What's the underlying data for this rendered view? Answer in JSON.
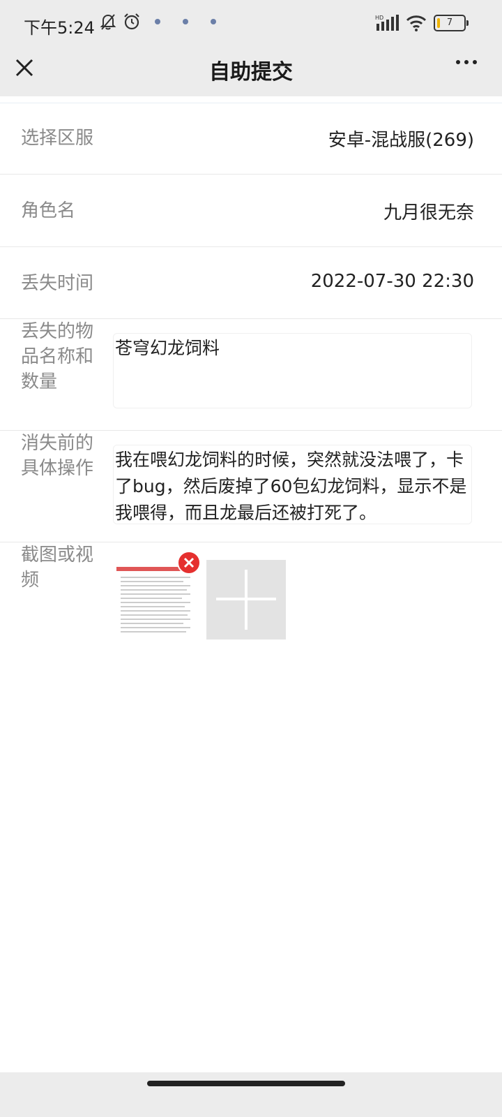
{
  "status_bar": {
    "time": "下午5:24",
    "icons_left": [
      "bell-off-icon",
      "alarm-icon"
    ],
    "network": "HD",
    "battery": "7",
    "battery_color": "#f0b400"
  },
  "nav": {
    "title": "自助提交",
    "close_icon": "close-icon",
    "more_icon": "more-icon"
  },
  "form": {
    "server_label": "选择区服",
    "server_value": "安卓-混战服(269)",
    "role_label": "角色名",
    "role_value": "九月很无奈",
    "time_label": "丢失时间",
    "time_value": "2022-07-30 22:30",
    "item_label": "丢失的物品名称和数量",
    "item_value": "苍穹幻龙饲料",
    "operation_label": "消失前的具体操作",
    "operation_value": "我在喂幻龙饲料的时候，突然就没法喂了，卡了bug，然后废掉了60包幻龙饲料，显示不是我喂得，而且龙最后还被打死了。",
    "screenshot_label": "截图或视频"
  },
  "colors": {
    "header_bg": "#ececec",
    "label_text": "#8a8a8a",
    "delete_badge": "#e5302f",
    "add_box_bg": "#e3e3e3"
  }
}
